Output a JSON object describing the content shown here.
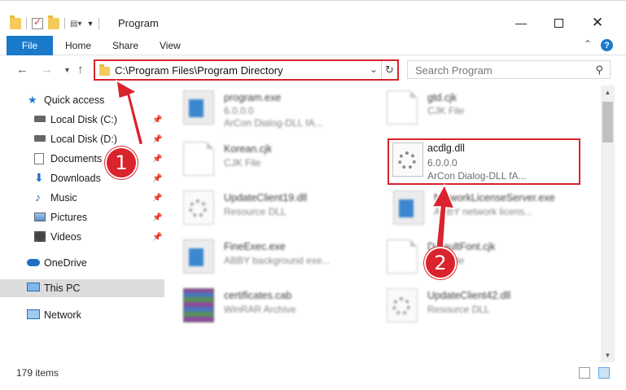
{
  "window": {
    "title": "Program",
    "minimize_icon": "minimize-icon",
    "maximize_icon": "maximize-icon",
    "close_icon": "close-icon"
  },
  "ribbon": {
    "tabs": [
      "File",
      "Home",
      "Share",
      "View"
    ],
    "accent_color": "#1979ca"
  },
  "address_bar": {
    "path": "C:\\Program Files\\Program Directory",
    "highlight_color": "#d9232d"
  },
  "search": {
    "placeholder": "Search Program"
  },
  "sidebar": {
    "items": [
      {
        "label": "Quick access",
        "icon": "star-icon"
      },
      {
        "label": "Local Disk (C:)",
        "icon": "drive-icon",
        "pinned": true
      },
      {
        "label": "Local Disk (D:)",
        "icon": "drive-icon",
        "pinned": true
      },
      {
        "label": "Documents",
        "icon": "documents-icon",
        "pinned": true
      },
      {
        "label": "Downloads",
        "icon": "download-icon",
        "pinned": true
      },
      {
        "label": "Music",
        "icon": "music-icon",
        "pinned": true
      },
      {
        "label": "Pictures",
        "icon": "pictures-icon",
        "pinned": true
      },
      {
        "label": "Videos",
        "icon": "videos-icon",
        "pinned": true
      },
      {
        "label": "OneDrive",
        "icon": "cloud-icon"
      },
      {
        "label": "This PC",
        "icon": "computer-icon",
        "selected": true
      },
      {
        "label": "Network",
        "icon": "network-icon"
      }
    ]
  },
  "files": [
    {
      "name": "program.exe",
      "line2": "6.0.0.0",
      "line3": "ArCon Dialog-DLL fA...",
      "icon": "exe-icon",
      "blurred": true
    },
    {
      "name": "gtd.cjk",
      "line2": "CJK File",
      "icon": "document-icon",
      "blurred": true
    },
    {
      "name": "Korean.cjk",
      "line2": "CJK File",
      "icon": "document-icon",
      "blurred": true
    },
    {
      "name": "acdlg.dll",
      "line2": "6.0.0.0",
      "line3": "ArCon Dialog-DLL fA...",
      "icon": "dll-gear-icon",
      "blurred": false
    },
    {
      "name": "UpdateClient19.dll",
      "line2": "Resource DLL",
      "icon": "dll-gear-icon",
      "blurred": true
    },
    {
      "name": "NetworkLicenseServer.exe",
      "line2": "ABBY network licens...",
      "icon": "exe-icon",
      "blurred": true
    },
    {
      "name": "FineExec.exe",
      "line2": "ABBY background exe...",
      "icon": "exe-icon",
      "blurred": true
    },
    {
      "name": "DefaultFont.cjk",
      "line2": "CJK File",
      "icon": "document-icon",
      "blurred": true
    },
    {
      "name": "certificates.cab",
      "line2": "WinRAR Archive",
      "icon": "archive-icon",
      "blurred": true
    },
    {
      "name": "UpdateClient42.dll",
      "line2": "Resource DLL",
      "icon": "dll-gear-icon",
      "blurred": true
    }
  ],
  "status": {
    "item_count": "179 items"
  },
  "annotations": {
    "step1": "1",
    "step2": "2",
    "color": "#d9232d"
  }
}
